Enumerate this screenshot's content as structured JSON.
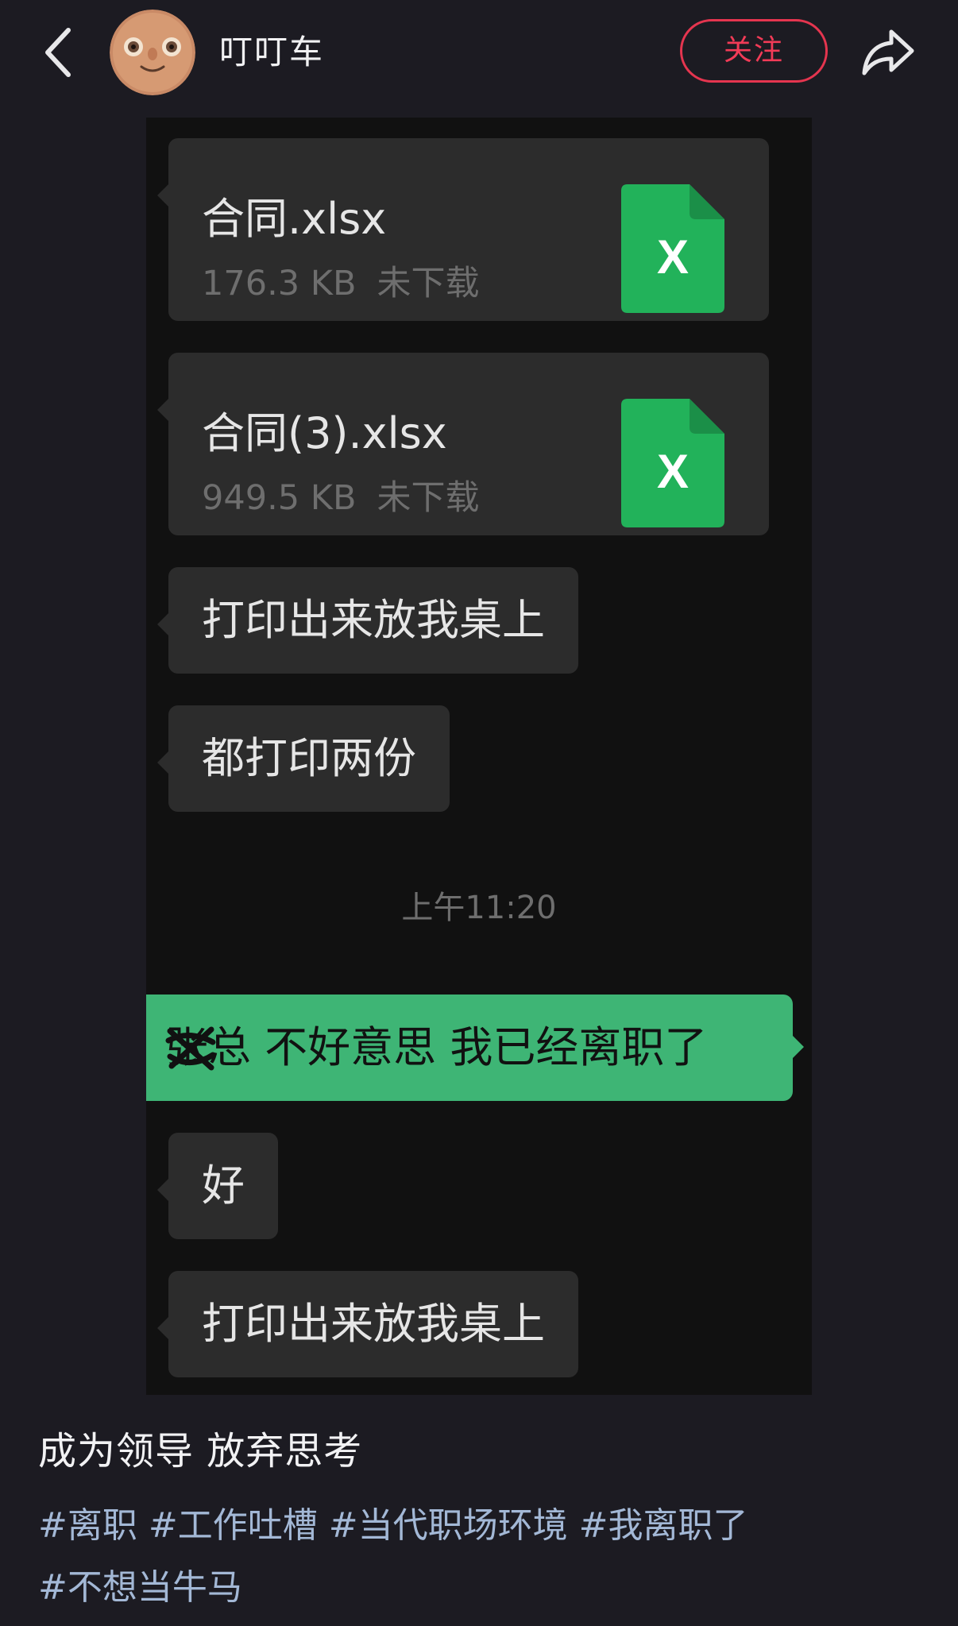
{
  "header": {
    "author_name": "叮叮车",
    "follow_label": "关注"
  },
  "chat": {
    "files": [
      {
        "name": "合同.xlsx",
        "size": "176.3 KB",
        "status": "未下载",
        "icon_letter": "X"
      },
      {
        "name": "合同(3).xlsx",
        "size": "949.5 KB",
        "status": "未下载",
        "icon_letter": "X"
      }
    ],
    "messages_before": [
      {
        "text": "打印出来放我桌上"
      },
      {
        "text": "都打印两份"
      }
    ],
    "timestamp": "上午11:20",
    "sent_message": "张总 不好意思 我已经离职了",
    "messages_after": [
      {
        "text": "好"
      },
      {
        "text": "打印出来放我桌上"
      }
    ]
  },
  "post": {
    "title": "成为领导 放弃思考",
    "hashtags": [
      "#离职",
      "#工作吐槽",
      "#当代职场环境",
      "#我离职了",
      "#不想当牛马"
    ]
  },
  "icons": {
    "back": "chevron-left-icon",
    "share": "share-arrow-icon",
    "excel": "excel-file-icon",
    "redaction": "scribble-redaction-mark"
  },
  "colors": {
    "background": "#1c1b22",
    "follow_accent": "#f23b57",
    "sent_bubble": "#3eb575",
    "received_bubble": "#2c2c2c",
    "excel_green": "#22b25a",
    "hashtag": "#a3b8d6"
  }
}
